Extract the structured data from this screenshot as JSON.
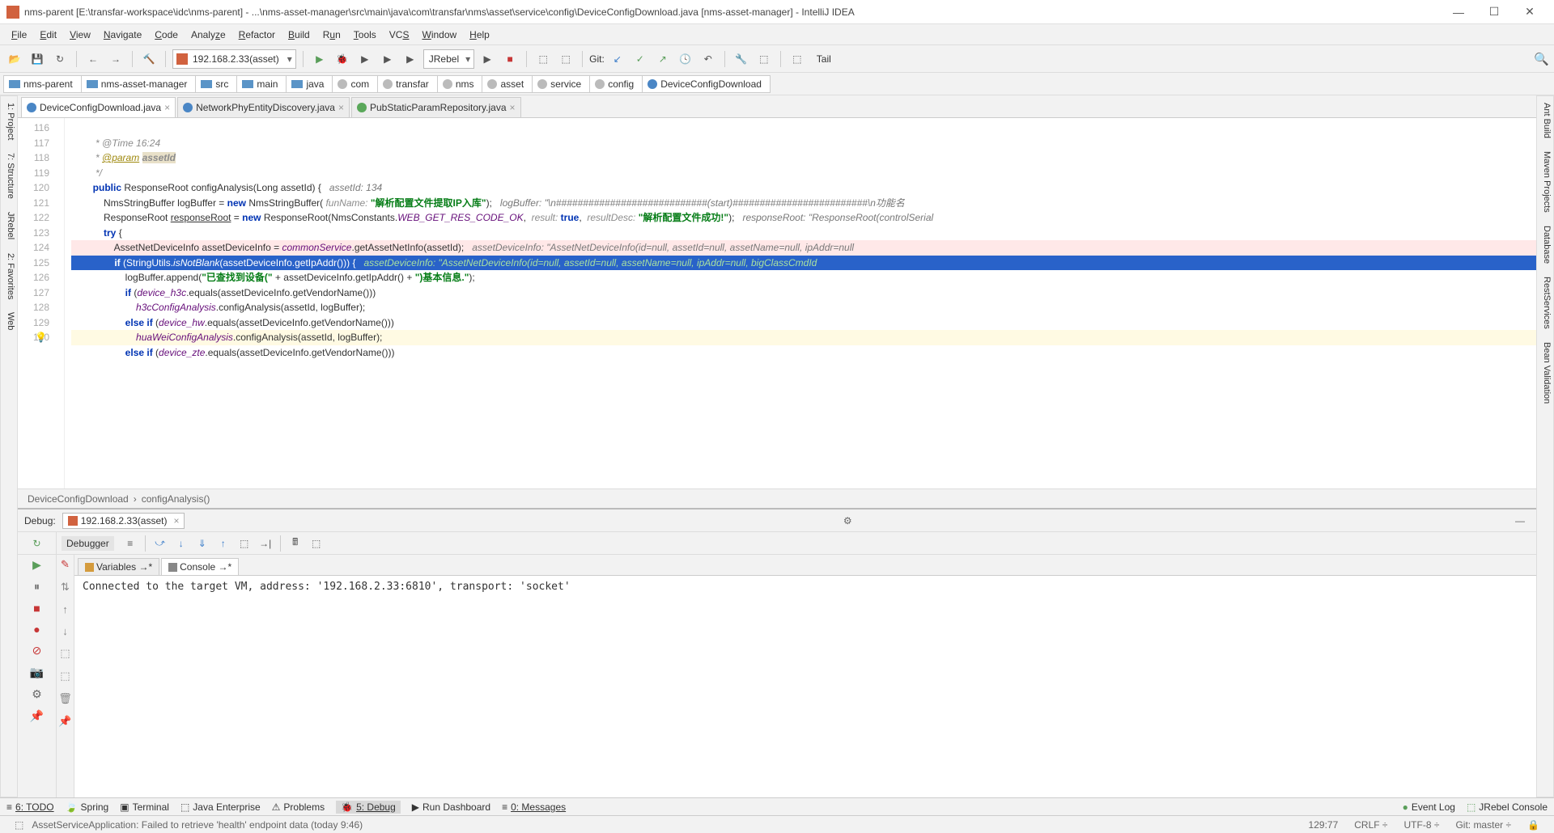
{
  "window": {
    "title": "nms-parent [E:\\transfar-workspace\\idc\\nms-parent] - ...\\nms-asset-manager\\src\\main\\java\\com\\transfar\\nms\\asset\\service\\config\\DeviceConfigDownload.java [nms-asset-manager] - IntelliJ IDEA",
    "min": "—",
    "max": "☐",
    "close": "✕"
  },
  "menu": [
    "File",
    "Edit",
    "View",
    "Navigate",
    "Code",
    "Analyze",
    "Refactor",
    "Build",
    "Run",
    "Tools",
    "VCS",
    "Window",
    "Help"
  ],
  "toolbar": {
    "runcfg": "192.168.2.33(asset)",
    "jrebel": "JRebel",
    "git": "Git:",
    "tail": "Tail"
  },
  "breadcrumbs": [
    {
      "t": "nms-parent",
      "k": "dir"
    },
    {
      "t": "nms-asset-manager",
      "k": "dir"
    },
    {
      "t": "src",
      "k": "dir"
    },
    {
      "t": "main",
      "k": "dir"
    },
    {
      "t": "java",
      "k": "dir"
    },
    {
      "t": "com",
      "k": "dir"
    },
    {
      "t": "transfar",
      "k": "dir"
    },
    {
      "t": "nms",
      "k": "dir"
    },
    {
      "t": "asset",
      "k": "dir"
    },
    {
      "t": "service",
      "k": "dir"
    },
    {
      "t": "config",
      "k": "dir"
    },
    {
      "t": "DeviceConfigDownload",
      "k": "cls"
    }
  ],
  "leftside": [
    "1: Project",
    "7: Structure",
    "JRebel",
    "2: Favorites",
    "Web"
  ],
  "rightside": [
    "Ant Build",
    "Maven Projects",
    "Database",
    "RestServices",
    "Bean Validation"
  ],
  "tabs": [
    {
      "t": "DeviceConfigDownload.java",
      "active": true,
      "k": "cls"
    },
    {
      "t": "NetworkPhyEntityDiscovery.java",
      "active": false,
      "k": "cls"
    },
    {
      "t": "PubStaticParamRepository.java",
      "active": false,
      "k": "iface"
    }
  ],
  "lines": [
    "116",
    "117",
    "118",
    "119",
    "120",
    "121",
    "122",
    "123",
    "124",
    "125",
    "126",
    "127",
    "128",
    "129",
    "130"
  ],
  "code": {
    "l116": "         * @Time 16:24",
    "l117": "         * @param assetId",
    "l118": "         */",
    "l119a": "        public",
    "l119b": " ResponseRoot configAnalysis(Long assetId) {   ",
    "l119c": "assetId: 134",
    "l120a": "            NmsStringBuffer logBuffer = ",
    "l120b": "new",
    "l120c": " NmsStringBuffer( ",
    "l120d": "funName:",
    "l120e": " \"解析配置文件提取IP入库\"",
    "l120f": ");   ",
    "l120g": "logBuffer: \"\\n############################(start)#########################\\n功能名",
    "l121a": "            ResponseRoot ",
    "l121u": "responseRoot",
    "l121b": " = ",
    "l121c": "new",
    "l121d": " ResponseRoot(NmsConstants.",
    "l121e": "WEB_GET_RES_CODE_OK",
    "l121f": ",  ",
    "l121g": "result:",
    "l121h": " true",
    "l121i": ",  ",
    "l121j": "resultDesc:",
    "l121k": " \"解析配置文件成功!\"",
    "l121l": ");   ",
    "l121m": "responseRoot: \"ResponseRoot(controlSerial",
    "l122": "            try {",
    "l123a": "                AssetNetDeviceInfo assetDeviceInfo = ",
    "l123b": "commonService",
    "l123c": ".getAssetNetInfo(assetId);   ",
    "l123d": "assetDeviceInfo: \"AssetNetDeviceInfo(id=null, assetId=null, assetName=null, ipAddr=null",
    "l124a": "                if",
    "l124b": " (StringUtils.",
    "l124c": "isNotBlank",
    "l124d": "(assetDeviceInfo.getIpAddr())) {   ",
    "l124e": "assetDeviceInfo: \"AssetNetDeviceInfo(id=null, assetId=null, assetName=null, ipAddr=null, bigClassCmdId",
    "l125a": "                    logBuffer.append(",
    "l125b": "\"已查找到设备(\"",
    "l125c": " + assetDeviceInfo.getIpAddr() + ",
    "l125d": "\")基本信息.\"",
    "l125e": ");",
    "l126a": "                    if",
    "l126b": " (",
    "l126c": "device_h3c",
    "l126d": ".equals(assetDeviceInfo.getVendorName()))",
    "l127a": "                        ",
    "l127b": "h3cConfigAnalysis",
    "l127c": ".configAnalysis(assetId, logBuffer);",
    "l128a": "                    else if",
    "l128b": " (",
    "l128c": "device_hw",
    "l128d": ".equals(assetDeviceInfo.getVendorName()))",
    "l129a": "                        ",
    "l129b": "huaWeiConfigAnalysis",
    "l129c": ".configAnalysis(assetId, logBuffer);",
    "l130a": "                    else if",
    "l130b": " (",
    "l130c": "device_zte",
    "l130d": ".equals(assetDeviceInfo.getVendorName()))"
  },
  "codecrumb": {
    "cls": "DeviceConfigDownload",
    "m": "configAnalysis()"
  },
  "debug": {
    "label": "Debug:",
    "cfg": "192.168.2.33(asset)",
    "debugger": "Debugger",
    "vars": "Variables →*",
    "console": "Console →*",
    "out": "Connected to the target VM, address: '192.168.2.33:6810', transport: 'socket'"
  },
  "bottom": {
    "todo": "6: TODO",
    "spring": "Spring",
    "terminal": "Terminal",
    "je": "Java Enterprise",
    "problems": "Problems",
    "dbg": "5: Debug",
    "rd": "Run Dashboard",
    "msg": "0: Messages",
    "ev": "Event Log",
    "jr": "JRebel Console"
  },
  "status": {
    "msg": "AssetServiceApplication: Failed to retrieve 'health' endpoint data (today 9:46)",
    "pos": "129:77",
    "crlf": "CRLF ÷",
    "enc": "UTF-8 ÷",
    "git": "Git: master ÷",
    "lock": "🔒"
  }
}
